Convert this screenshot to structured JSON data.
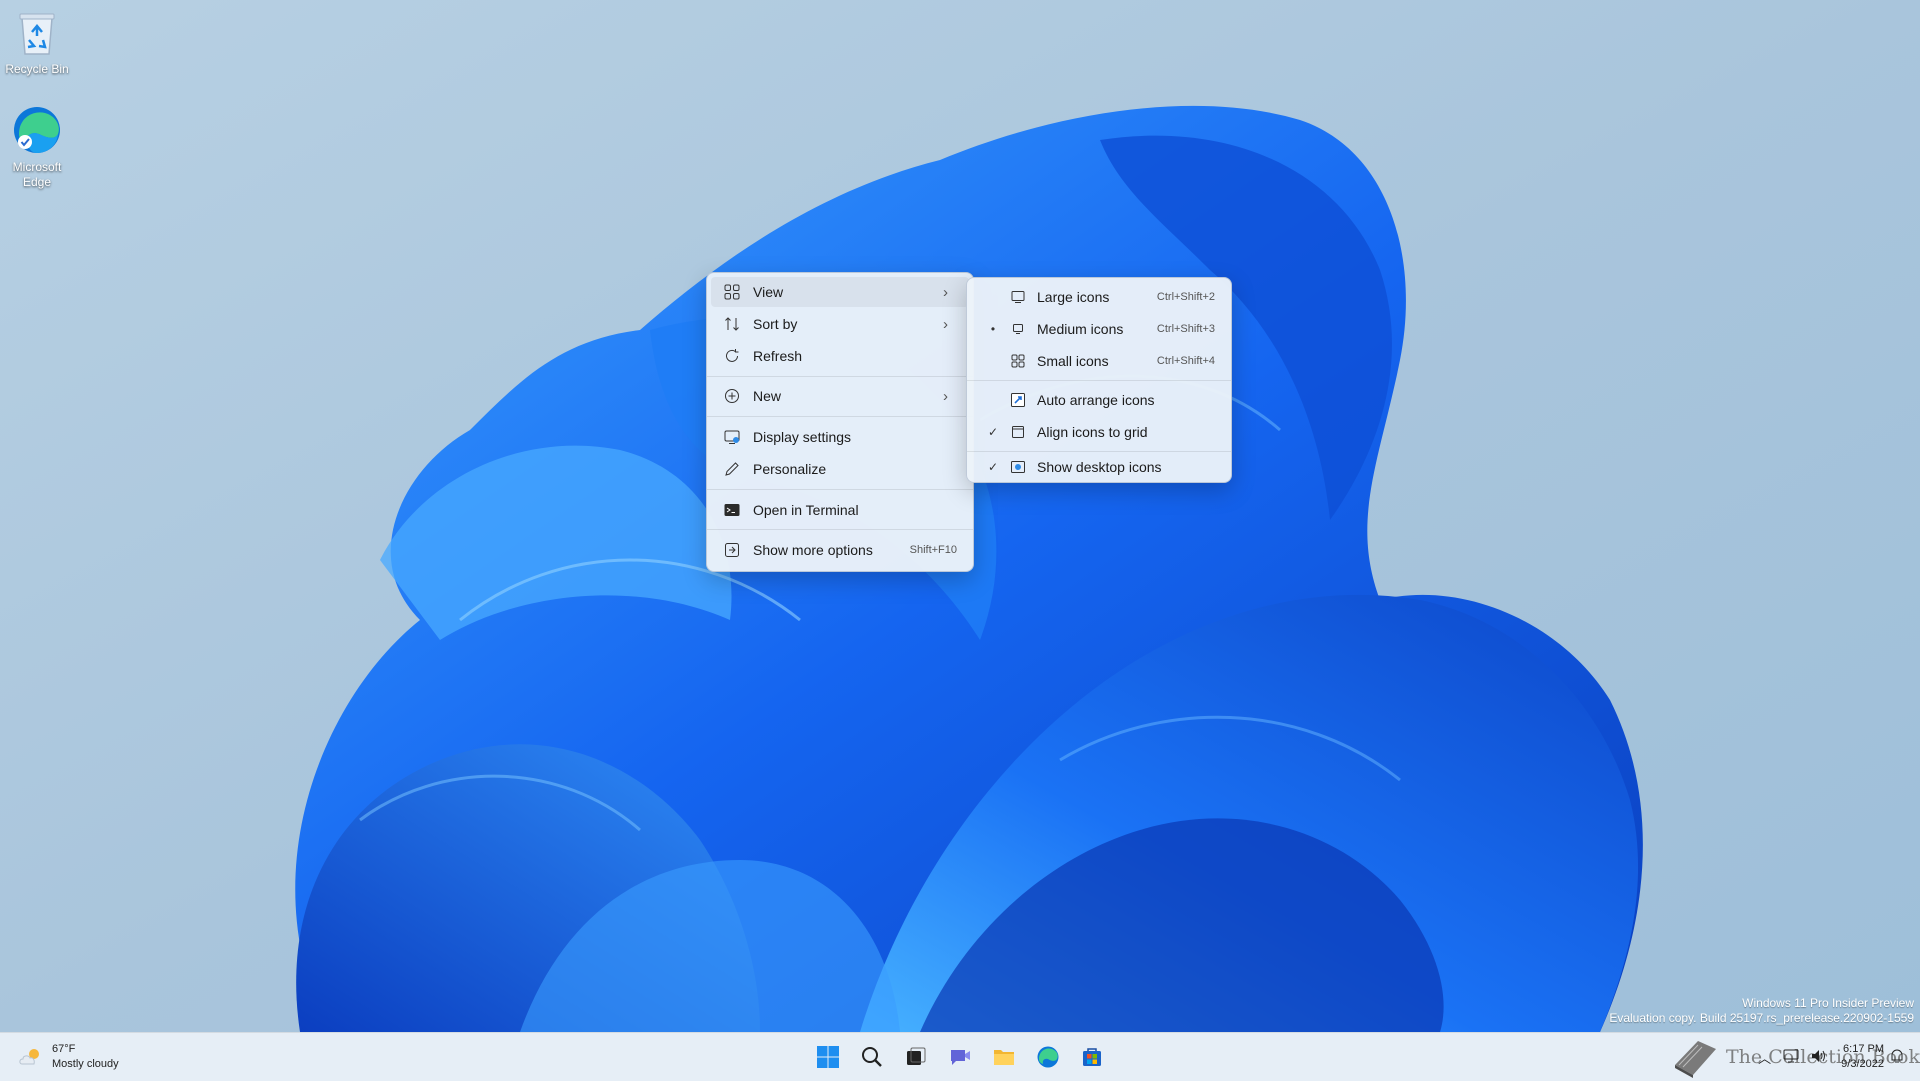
{
  "desktop": {
    "icons": [
      {
        "label": "Recycle Bin",
        "icon": "recycle-bin-icon"
      },
      {
        "label": "Microsoft Edge",
        "icon": "edge-icon"
      }
    ]
  },
  "watermark": {
    "line1": "Windows 11 Pro Insider Preview",
    "line2": "Evaluation copy. Build 25197.rs_prerelease.220902-1559"
  },
  "context_menu": {
    "items": [
      {
        "label": "View",
        "icon": "grid-icon",
        "has_submenu": true
      },
      {
        "label": "Sort by",
        "icon": "sort-icon",
        "has_submenu": true
      },
      {
        "label": "Refresh",
        "icon": "refresh-icon"
      },
      {
        "label": "New",
        "icon": "plus-circle-icon",
        "has_submenu": true
      },
      {
        "label": "Display settings",
        "icon": "display-icon"
      },
      {
        "label": "Personalize",
        "icon": "pen-icon"
      },
      {
        "label": "Open in Terminal",
        "icon": "terminal-icon"
      },
      {
        "label": "Show more options",
        "icon": "more-options-icon",
        "shortcut": "Shift+F10"
      }
    ]
  },
  "view_submenu": {
    "items": [
      {
        "label": "Large icons",
        "icon": "monitor-icon",
        "shortcut": "Ctrl+Shift+2",
        "mark": ""
      },
      {
        "label": "Medium icons",
        "icon": "monitor-small-icon",
        "shortcut": "Ctrl+Shift+3",
        "mark": "•"
      },
      {
        "label": "Small icons",
        "icon": "small-grid-icon",
        "shortcut": "Ctrl+Shift+4",
        "mark": ""
      },
      {
        "label": "Auto arrange icons",
        "icon": "auto-arrange-icon",
        "mark": ""
      },
      {
        "label": "Align icons to grid",
        "icon": "align-grid-icon",
        "mark": "✓"
      },
      {
        "label": "Show desktop icons",
        "icon": "show-desktop-icon",
        "mark": "✓"
      }
    ]
  },
  "taskbar": {
    "weather": {
      "temp": "67°F",
      "condition": "Mostly cloudy"
    },
    "pinned": [
      "start-icon",
      "search-icon",
      "task-view-icon",
      "chat-icon",
      "file-explorer-icon",
      "edge-icon",
      "store-icon"
    ],
    "clock": {
      "time": "6:17 PM",
      "date": "9/3/2022"
    },
    "site_logo_text": "The Collection Book"
  },
  "colors": {
    "accent": "#0067c0",
    "wallpaper_blue": "#1a6cf0"
  }
}
